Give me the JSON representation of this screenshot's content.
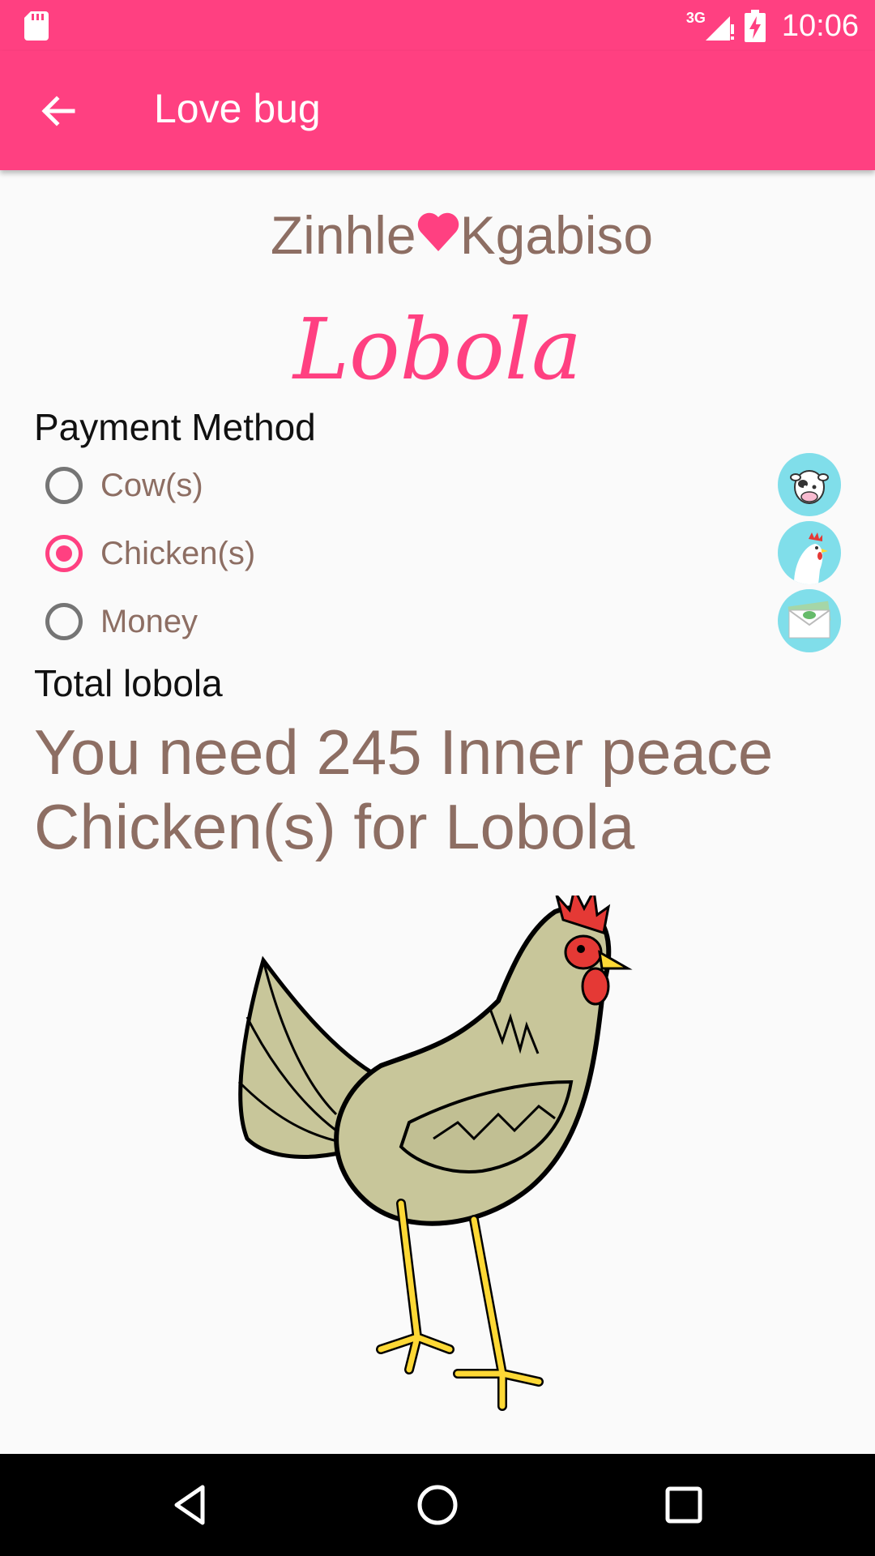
{
  "status_bar": {
    "time": "10:06",
    "network": "3G"
  },
  "app_bar": {
    "title": "Love bug"
  },
  "couple": {
    "partner1": "Zinhle",
    "partner2": "Kgabiso"
  },
  "page_title": "Lobola",
  "payment": {
    "label": "Payment Method",
    "options": [
      {
        "label": "Cow(s)",
        "checked": false,
        "icon": "cow-icon"
      },
      {
        "label": "Chicken(s)",
        "checked": true,
        "icon": "chicken-icon"
      },
      {
        "label": "Money",
        "checked": false,
        "icon": "money-envelope-icon"
      }
    ]
  },
  "total": {
    "label": "Total lobola",
    "text": "You need 245 Inner peace Chicken(s) for Lobola"
  },
  "colors": {
    "accent": "#ff4081",
    "text_brown": "#8d6e63",
    "avatar_bg": "#80deea"
  }
}
